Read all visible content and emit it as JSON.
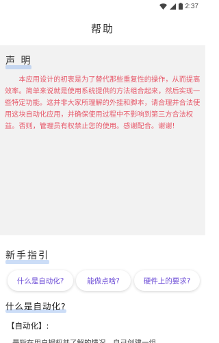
{
  "status_bar": {
    "time": "2:37"
  },
  "app_bar": {
    "title": "帮助"
  },
  "statement": {
    "heading": "声 明",
    "body": "本应用设计的初衷是为了替代那些重复性的操作，从而提高效率。简单来说就是使用系统提供的方法组合起来，然后实现一些特定功能。这并非大家所理解的外挂和脚本，请合理并合法使用这块自动化应用，并确保使用过程中不影响到第三方合法权益。否则，管理员有权禁止您的使用。感谢配合。谢谢!"
  },
  "guide": {
    "heading": "新手指引",
    "chips": [
      "什么是自动化?",
      "能做点啥?",
      "硬件上的要求?"
    ]
  },
  "what_is": {
    "heading": "什么是自动化?",
    "term": "【自动化】:",
    "desc": "是指在用户授权并了解的情况，自己创建一组"
  },
  "colors": {
    "statement_text": "#e7596a",
    "chip_text": "#6b4bd6",
    "underline": "#8fb3ee"
  }
}
